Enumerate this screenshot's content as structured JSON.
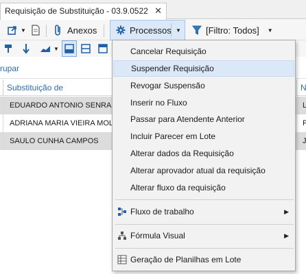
{
  "tab": {
    "title": "Requisição de Substituição - 03.9.0522",
    "close": "✕"
  },
  "toolbar": {
    "anexos": "Anexos",
    "processos": "Processos",
    "filtro": "[Filtro: Todos]"
  },
  "group_bar": {
    "label": "rupar"
  },
  "grid": {
    "columns": [
      "Substituição de",
      "N"
    ],
    "rows": [
      {
        "name": "EDUARDO ANTONIO SENRA NA",
        "tail": "L"
      },
      {
        "name": "ADRIANA MARIA VIEIRA MOLL",
        "tail": "P"
      },
      {
        "name": "SAULO CUNHA CAMPOS",
        "tail": "J"
      }
    ]
  },
  "menu": {
    "items": [
      "Cancelar Requisição",
      "Suspender Requisição",
      "Revogar Suspensão",
      "Inserir no Fluxo",
      "Passar para Atendente Anterior",
      "Incluir Parecer em Lote",
      "Alterar dados da Requisição",
      "Alterar aprovador atual da requisição",
      "Alterar fluxo da requisição"
    ],
    "submenus": [
      "Fluxo de trabalho",
      "Fórmula Visual"
    ],
    "footer": "Geração de Planilhas em Lote",
    "highlighted": "Suspender Requisição"
  },
  "colors": {
    "accent": "#2c6aa8",
    "highlight": "#dbe8f8",
    "gear": "#1f5fa8"
  }
}
